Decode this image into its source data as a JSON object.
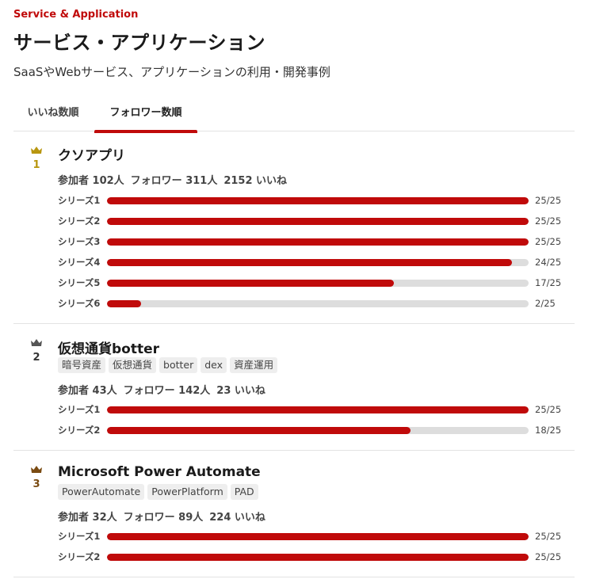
{
  "category": "Service & Application",
  "title": "サービス・アプリケーション",
  "description": "SaaSやWebサービス、アプリケーションの利用・開発事例",
  "tabs": [
    {
      "label": "いいね数順",
      "active": false
    },
    {
      "label": "フォロワー数順",
      "active": true
    }
  ],
  "colors": {
    "accent": "#c00a0a",
    "gold": "#b8960f",
    "silver": "#555555",
    "bronze": "#7a4b12"
  },
  "entries": [
    {
      "rank": "1",
      "crown": "gold-crown-icon",
      "name": "クソアプリ",
      "tags": [],
      "stats": {
        "participants": "参加者 102人",
        "followers": "フォロワー 311人",
        "likes": "2152 いいね"
      },
      "series": [
        {
          "label": "シリーズ1",
          "count": "25/25",
          "progress": 1.0
        },
        {
          "label": "シリーズ2",
          "count": "25/25",
          "progress": 1.0
        },
        {
          "label": "シリーズ3",
          "count": "25/25",
          "progress": 1.0
        },
        {
          "label": "シリーズ4",
          "count": "24/25",
          "progress": 0.96
        },
        {
          "label": "シリーズ5",
          "count": "17/25",
          "progress": 0.68
        },
        {
          "label": "シリーズ6",
          "count": "2/25",
          "progress": 0.08
        }
      ]
    },
    {
      "rank": "2",
      "crown": "silver-crown-icon",
      "name": "仮想通貨botter",
      "tags": [
        "暗号資産",
        "仮想通貨",
        "botter",
        "dex",
        "資産運用"
      ],
      "stats": {
        "participants": "参加者 43人",
        "followers": "フォロワー 142人",
        "likes": "23 いいね"
      },
      "series": [
        {
          "label": "シリーズ1",
          "count": "25/25",
          "progress": 1.0
        },
        {
          "label": "シリーズ2",
          "count": "18/25",
          "progress": 0.72
        }
      ]
    },
    {
      "rank": "3",
      "crown": "bronze-crown-icon",
      "name": "Microsoft Power Automate",
      "tags": [
        "PowerAutomate",
        "PowerPlatform",
        "PAD"
      ],
      "stats": {
        "participants": "参加者 32人",
        "followers": "フォロワー 89人",
        "likes": "224 いいね"
      },
      "series": [
        {
          "label": "シリーズ1",
          "count": "25/25",
          "progress": 1.0
        },
        {
          "label": "シリーズ2",
          "count": "25/25",
          "progress": 1.0
        }
      ]
    }
  ]
}
